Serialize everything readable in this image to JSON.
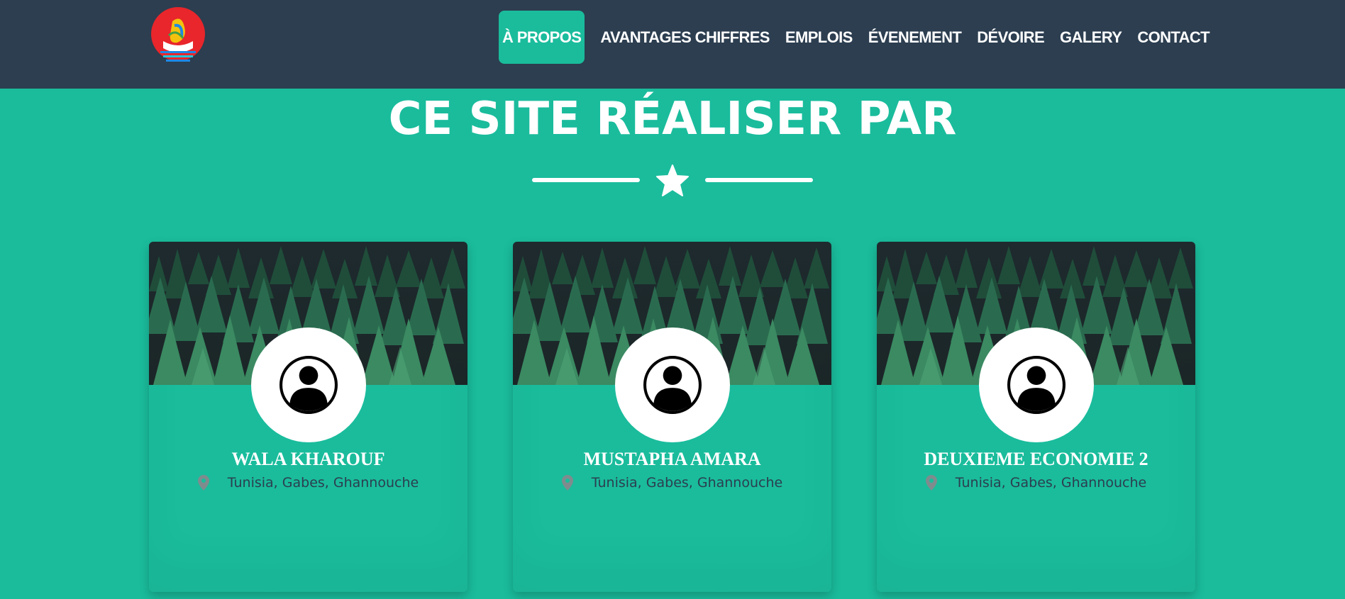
{
  "nav": {
    "logo_alt": "site-logo",
    "links": [
      {
        "label": "À PROPOS",
        "active": true
      },
      {
        "label": "AVANTAGES CHIFFRES",
        "active": false
      },
      {
        "label": "EMPLOIS",
        "active": false
      },
      {
        "label": "ÉVENEMENT",
        "active": false
      },
      {
        "label": "DÉVOIRE",
        "active": false
      },
      {
        "label": "GALERY",
        "active": false
      },
      {
        "label": "CONTACT",
        "active": false
      }
    ]
  },
  "section": {
    "title": "CE SITE RÉALISER PAR",
    "divider_icon": "star-icon"
  },
  "cards": [
    {
      "name": "WALA KHAROUF",
      "location": "Tunisia, Gabes, Ghannouche"
    },
    {
      "name": "MUSTAPHA AMARA",
      "location": "Tunisia, Gabes, Ghannouche"
    },
    {
      "name": "DEUXIEME ECONOMIE 2",
      "location": "Tunisia, Gabes, Ghannouche"
    }
  ],
  "colors": {
    "navbar": "#2c3e50",
    "accent": "#1abc9c",
    "text_light": "#ffffff",
    "text_dark": "#2c3e50",
    "pin": "#7f8c8d"
  }
}
